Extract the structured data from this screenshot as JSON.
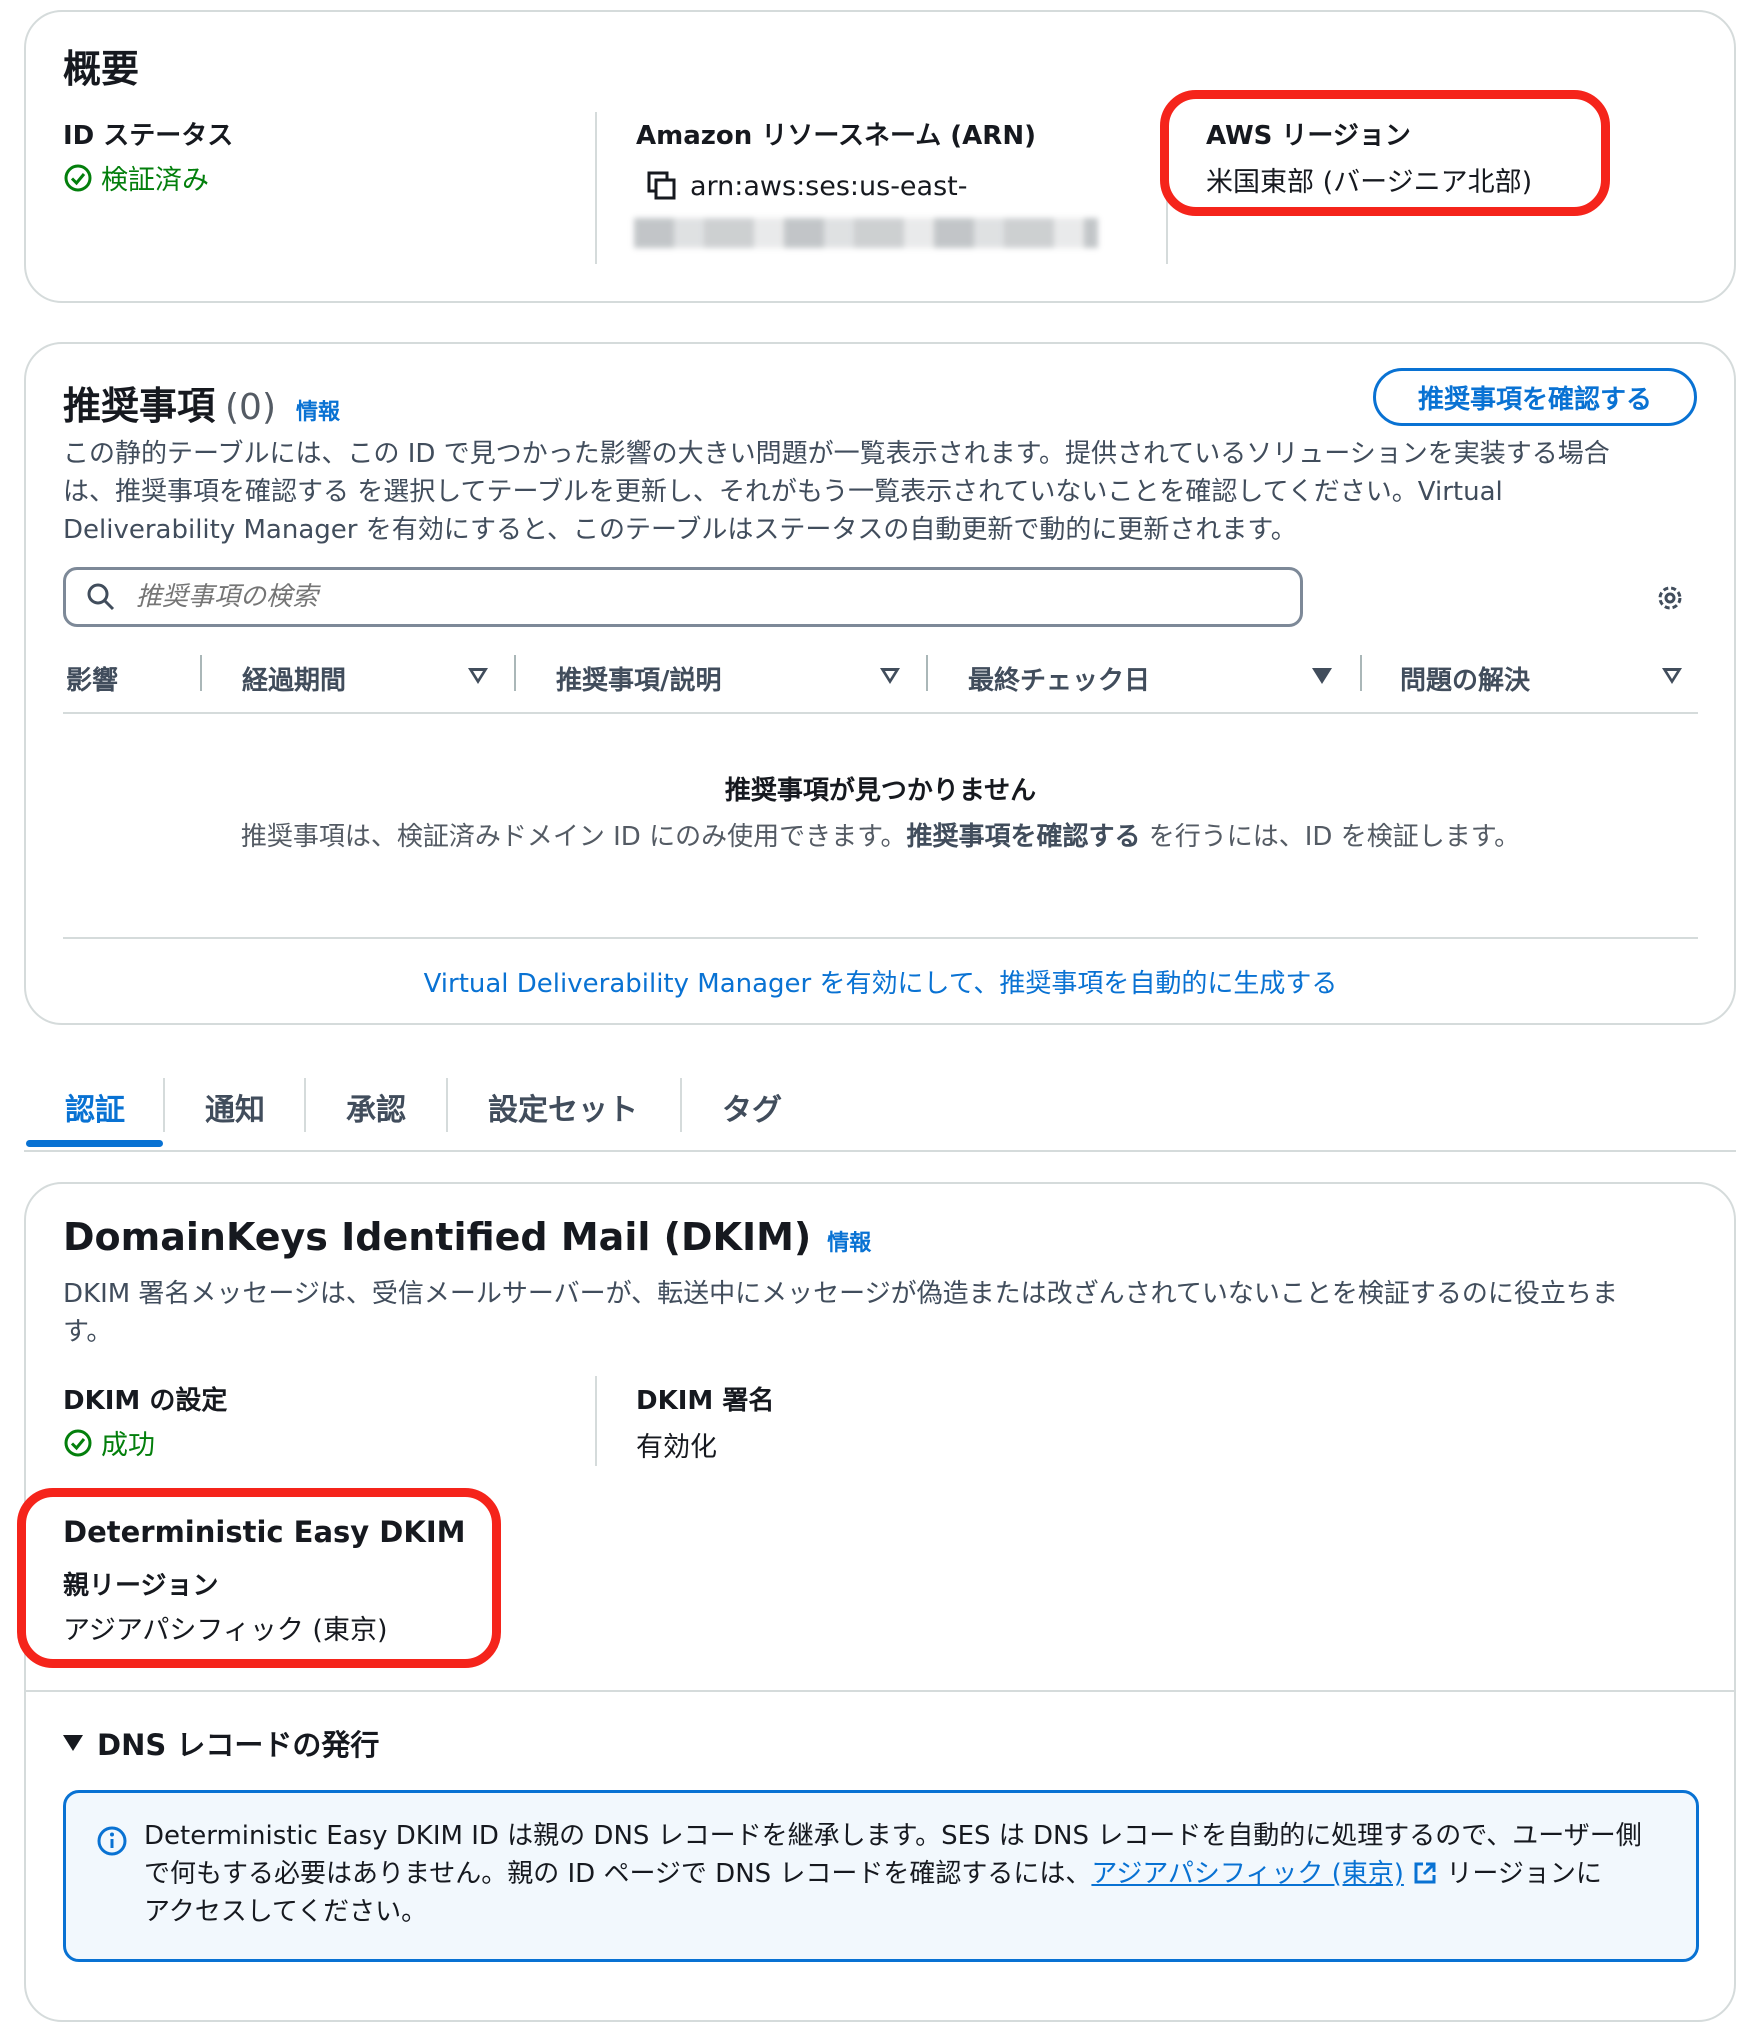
{
  "overview": {
    "title": "概要",
    "id_status_label": "ID ステータス",
    "id_status_value": "検証済み",
    "arn_label": "Amazon リソースネーム (ARN)",
    "arn_value": "arn:aws:ses:us-east-",
    "region_label": "AWS リージョン",
    "region_value": "米国東部 (バージニア北部)"
  },
  "recommendations": {
    "title": "推奨事項",
    "count": "(0)",
    "info": "情報",
    "review_button": "推奨事項を確認する",
    "description_lines": [
      "この静的テーブルには、この ID で見つかった影響の大きい問題が一覧表示されます。提供されているソリューションを実装する場合",
      "は、推奨事項を確認する を選択してテーブルを更新し、それがもう一覧表示されていないことを確認してください。Virtual",
      "Deliverability Manager を有効にすると、このテーブルはステータスの自動更新で動的に更新されます。"
    ],
    "search_placeholder": "推奨事項の検索",
    "columns": [
      "影響",
      "経過期間",
      "推奨事項/説明",
      "最終チェック日",
      "問題の解決"
    ],
    "empty_title": "推奨事項が見つかりません",
    "empty_text_1": "推奨事項は、検証済みドメイン ID にのみ使用できます。",
    "empty_text_bold": "推奨事項を確認する",
    "empty_text_2": " を行うには、ID を検証します。",
    "vdm_link": "Virtual Deliverability Manager を有効にして、推奨事項を自動的に生成する"
  },
  "tabs": [
    "認証",
    "通知",
    "承認",
    "設定セット",
    "タグ"
  ],
  "dkim": {
    "title": "DomainKeys Identified Mail (DKIM)",
    "info": "情報",
    "description_lines": [
      "DKIM 署名メッセージは、受信メールサーバーが、転送中にメッセージが偽造または改ざんされていないことを検証するのに役立ちま",
      "す。"
    ],
    "config_label": "DKIM の設定",
    "config_value": "成功",
    "signing_label": "DKIM 署名",
    "signing_value": "有効化",
    "easy_title": "Deterministic Easy DKIM",
    "parent_label": "親リージョン",
    "parent_value": "アジアパシフィック (東京)",
    "dns_title": "DNS レコードの発行",
    "notice_1": "Deterministic Easy DKIM ID は親の DNS レコードを継承します。SES は DNS レコードを自動的に処理するので、ユーザー側",
    "notice_2a": "で何もする必要はありません。親の ID ページで DNS レコードを確認するには、",
    "notice_link": "アジアパシフィック (東京)",
    "notice_2b": " リージョンに",
    "notice_3": "アクセスしてください。"
  },
  "colors": {
    "accent": "#0972d3",
    "success": "#037f0c",
    "highlight": "#f5241b"
  }
}
